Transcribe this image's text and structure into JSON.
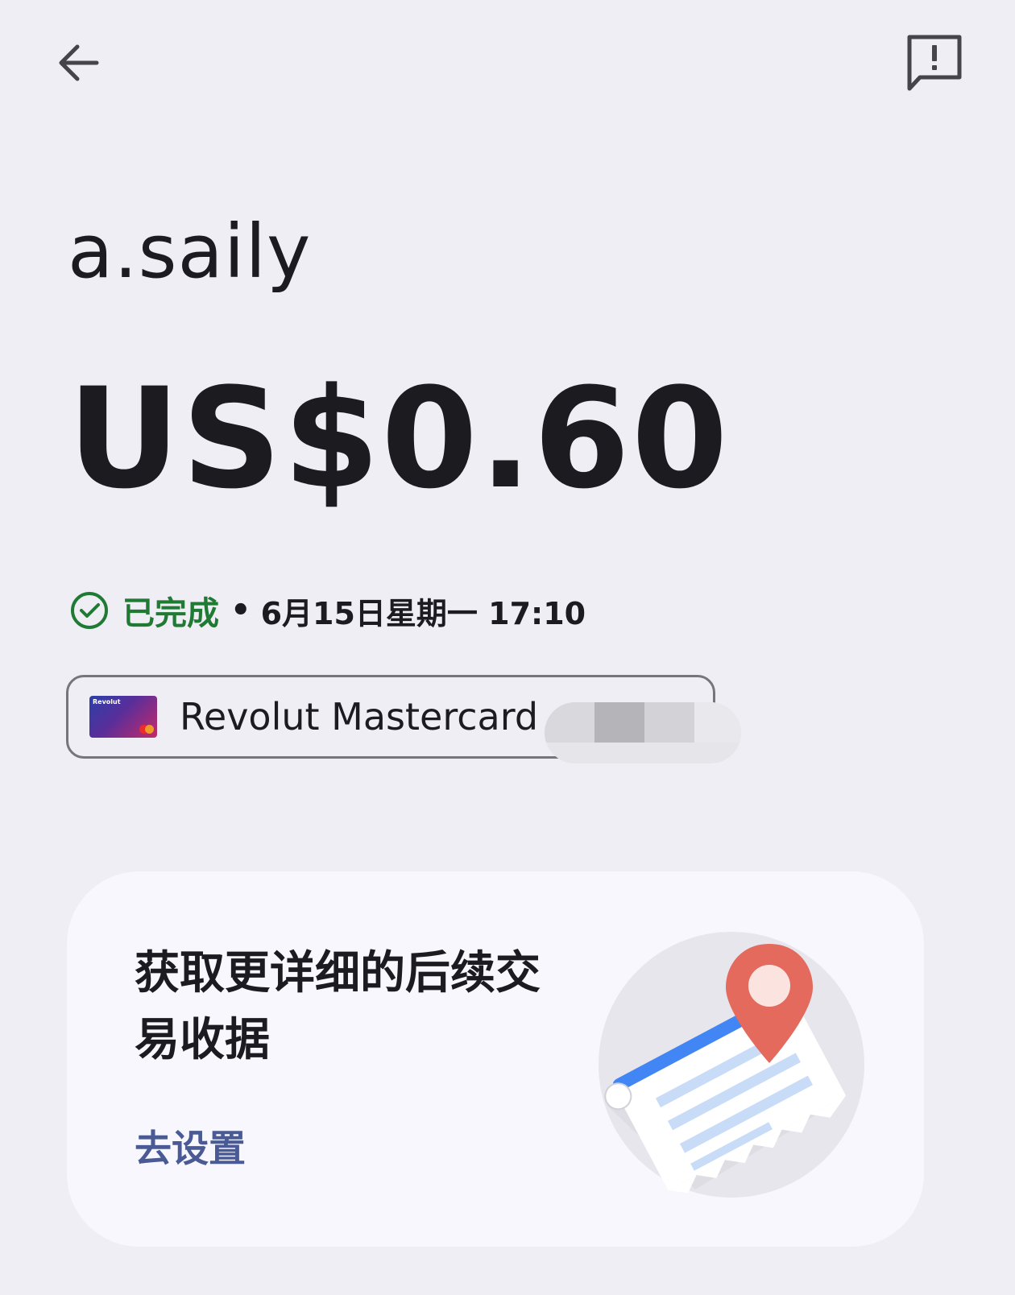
{
  "header": {
    "back_icon": "arrow-left-icon",
    "feedback_icon": "report-feedback-icon"
  },
  "transaction": {
    "merchant": "a.saily",
    "amount": "US$0.60",
    "status": "已完成",
    "separator": "•",
    "datetime": "6月15日星期一 17:10",
    "status_color": "#1f7a34"
  },
  "payment_method": {
    "card_name": "Revolut Mastercard",
    "card_brand": "Revolut",
    "card_icon": "revolut-card-icon"
  },
  "receipt_promo": {
    "title": "获取更详细的后续交易收据",
    "action_label": "去设置",
    "action_color": "#4a5a94",
    "illustration": "receipt-location-pin-illustration"
  }
}
